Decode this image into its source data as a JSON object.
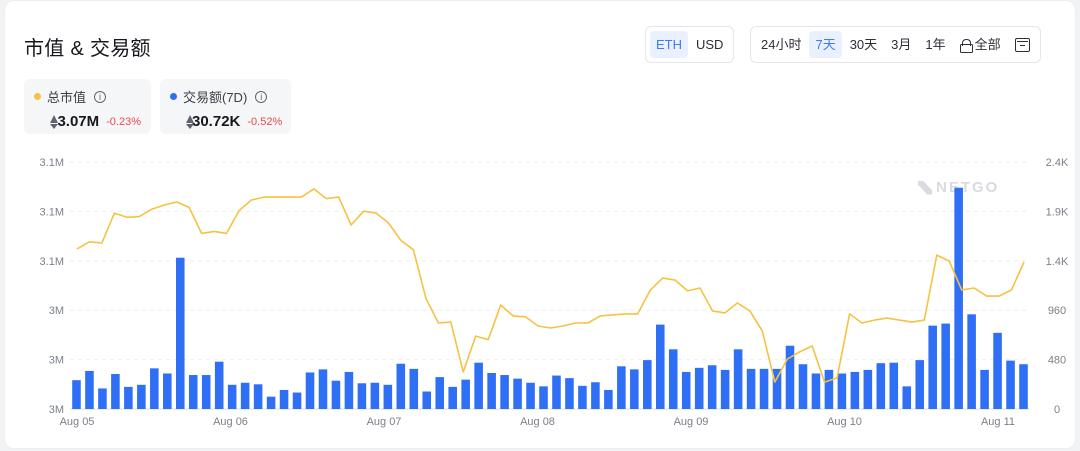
{
  "title": "市值 & 交易额",
  "currency_toggle": {
    "options": [
      "ETH",
      "USD"
    ],
    "selected": "ETH"
  },
  "range_toggle": {
    "options": [
      "24小时",
      "7天",
      "30天",
      "3月",
      "1年",
      "全部"
    ],
    "selected": "7天",
    "calendar_icon": "calendar-icon",
    "all_icon": "lock-icon"
  },
  "legend": [
    {
      "name": "总市值",
      "value": "3.07M",
      "change": "-0.23%",
      "color": "#f5c242",
      "icon": "info-icon"
    },
    {
      "name": "交易额(7D)",
      "value": "30.72K",
      "change": "-0.52%",
      "color": "#2f6ff5",
      "icon": "info-icon"
    }
  ],
  "watermark": "NETGO",
  "colors": {
    "line": "#f5c242",
    "bars": "#2f6ff5",
    "active": "#3f7bf6",
    "negative": "#f04848"
  },
  "chart_data": {
    "type": "bar+line",
    "x_ticks": [
      "Aug 05",
      "Aug 06",
      "Aug 07",
      "Aug 08",
      "Aug 09",
      "Aug 10",
      "Aug 11"
    ],
    "left_axis_ticks": [
      "3M",
      "3M",
      "3M",
      "3.1M",
      "3.1M",
      "3.1M"
    ],
    "right_axis_ticks": [
      "0",
      "480",
      "960",
      "1.4K",
      "1.9K",
      "2.4K"
    ],
    "right_ylim": [
      0,
      2400
    ],
    "left_ylim_normalized": [
      0,
      1
    ],
    "grid": true,
    "series": [
      {
        "name": "交易额(7D)",
        "type": "bar",
        "axis": "right",
        "values": [
          280,
          370,
          200,
          340,
          215,
          235,
          395,
          345,
          1470,
          330,
          330,
          460,
          235,
          255,
          240,
          120,
          185,
          160,
          355,
          385,
          275,
          360,
          250,
          255,
          235,
          440,
          390,
          170,
          310,
          215,
          285,
          450,
          350,
          330,
          295,
          255,
          220,
          325,
          300,
          225,
          260,
          185,
          415,
          385,
          475,
          820,
          580,
          360,
          400,
          425,
          380,
          580,
          390,
          390,
          390,
          615,
          435,
          345,
          380,
          345,
          360,
          380,
          445,
          450,
          220,
          475,
          810,
          830,
          2150,
          920,
          380,
          740,
          470,
          435
        ]
      },
      {
        "name": "总市值",
        "type": "line",
        "axis": "left",
        "values": [
          0.648,
          0.677,
          0.672,
          0.793,
          0.776,
          0.779,
          0.809,
          0.826,
          0.838,
          0.816,
          0.711,
          0.719,
          0.711,
          0.803,
          0.846,
          0.858,
          0.858,
          0.858,
          0.858,
          0.891,
          0.852,
          0.858,
          0.745,
          0.801,
          0.793,
          0.753,
          0.682,
          0.645,
          0.448,
          0.348,
          0.352,
          0.15,
          0.295,
          0.281,
          0.421,
          0.377,
          0.373,
          0.336,
          0.328,
          0.336,
          0.348,
          0.348,
          0.377,
          0.381,
          0.385,
          0.385,
          0.481,
          0.53,
          0.522,
          0.478,
          0.49,
          0.397,
          0.389,
          0.429,
          0.397,
          0.316,
          0.109,
          0.202,
          0.231,
          0.255,
          0.109,
          0.126,
          0.385,
          0.348,
          0.36,
          0.368,
          0.36,
          0.352,
          0.36,
          0.623,
          0.599,
          0.482,
          0.49,
          0.457,
          0.457,
          0.482,
          0.595
        ]
      }
    ]
  }
}
